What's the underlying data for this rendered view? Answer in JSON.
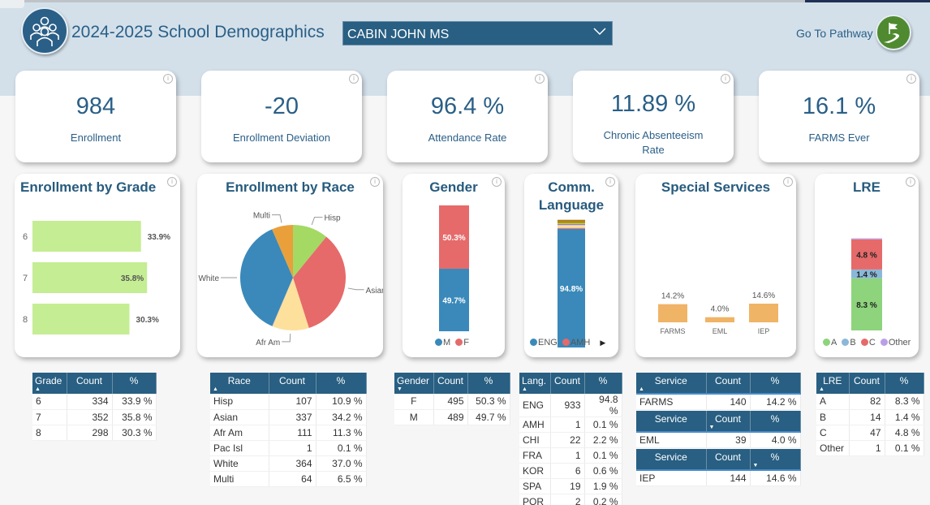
{
  "header": {
    "title": "2024-2025 School Demographics",
    "school_selected": "CABIN JOHN MS",
    "pathway_label": "Go To Pathway"
  },
  "kpis": [
    {
      "value": "984",
      "label": "Enrollment"
    },
    {
      "value": "-20",
      "label": "Enrollment Deviation"
    },
    {
      "value": "96.4 %",
      "label": "Attendance Rate"
    },
    {
      "value": "11.89 %",
      "label": "Chronic Absenteeism Rate"
    },
    {
      "value": "16.1 %",
      "label": "FARMS Ever"
    }
  ],
  "info_icon": "i",
  "colors": {
    "brand": "#285f82",
    "grade_bar": "#c5ed94",
    "service_bar": "#f0b466",
    "m": "#3a89ba",
    "f": "#e66a6a"
  },
  "chart_data": [
    {
      "type": "bar",
      "orientation": "horizontal",
      "title": "Enrollment by Grade",
      "categories": [
        "6",
        "7",
        "8"
      ],
      "values": [
        33.9,
        35.8,
        30.3
      ],
      "labels": [
        "33.9%",
        "35.8%",
        "30.3%"
      ],
      "color": "#c5ed94"
    },
    {
      "type": "pie",
      "title": "Enrollment by Race",
      "categories": [
        "Hisp",
        "Asian",
        "Afr Am",
        "Pac Isl",
        "White",
        "Multi"
      ],
      "values": [
        10.9,
        34.2,
        11.3,
        0.1,
        37.0,
        6.5
      ],
      "colors": [
        "#a4d964",
        "#e66a6a",
        "#fde09c",
        "#8a6fc0",
        "#3a89ba",
        "#e9a03b"
      ],
      "slice_labels": [
        "Hisp",
        "Asian",
        "Afr Am",
        "",
        "White",
        "Multi"
      ]
    },
    {
      "type": "bar",
      "stacked": true,
      "title": "Gender",
      "series": [
        {
          "name": "M",
          "value": 49.7,
          "label": "49.7%",
          "color": "#3a89ba"
        },
        {
          "name": "F",
          "value": 50.3,
          "label": "50.3%",
          "color": "#e66a6a"
        }
      ],
      "legend": [
        "M",
        "F"
      ]
    },
    {
      "type": "bar",
      "stacked": true,
      "title": "Comm. Language",
      "series": [
        {
          "name": "ENG",
          "value": 94.8,
          "label": "94.8%",
          "color": "#3a89ba"
        },
        {
          "name": "AMH",
          "value": 0.1,
          "label": "",
          "color": "#e66a6a"
        },
        {
          "name": "CHI",
          "value": 2.2,
          "label": "",
          "color": "#fde09c"
        },
        {
          "name": "FRA",
          "value": 0.1,
          "label": "",
          "color": "#8a6fc0"
        },
        {
          "name": "KOR",
          "value": 0.6,
          "label": "",
          "color": "#a4d964"
        },
        {
          "name": "SPA",
          "value": 1.9,
          "label": "",
          "color": "#b8860b"
        },
        {
          "name": "POR",
          "value": 0.2,
          "label": "",
          "color": "#9c7a1a"
        }
      ],
      "legend": [
        "ENG",
        "AMH"
      ]
    },
    {
      "type": "bar",
      "title": "Special Services",
      "categories": [
        "FARMS",
        "EML",
        "IEP"
      ],
      "values": [
        14.2,
        4.0,
        14.6
      ],
      "labels": [
        "14.2%",
        "4.0%",
        "14.6%"
      ],
      "color": "#f0b466"
    },
    {
      "type": "bar",
      "stacked": true,
      "title": "LRE",
      "series": [
        {
          "name": "A",
          "value": 8.3,
          "label": "8.3 %",
          "color": "#8dd47c"
        },
        {
          "name": "B",
          "value": 1.4,
          "label": "1.4 %",
          "color": "#8ab8d8"
        },
        {
          "name": "C",
          "value": 4.8,
          "label": "4.8 %",
          "color": "#e66a6a"
        },
        {
          "name": "Other",
          "value": 0.1,
          "label": "",
          "color": "#b9a0e6"
        }
      ],
      "legend": [
        "A",
        "B",
        "C",
        "Other"
      ]
    }
  ],
  "tables": {
    "grade": {
      "headers": [
        "Grade",
        "Count",
        "%"
      ],
      "rows": [
        [
          "6",
          "334",
          "33.9 %"
        ],
        [
          "7",
          "352",
          "35.8 %"
        ],
        [
          "8",
          "298",
          "30.3 %"
        ]
      ]
    },
    "race": {
      "headers": [
        "Race",
        "Count",
        "%"
      ],
      "rows": [
        [
          "Hisp",
          "107",
          "10.9 %"
        ],
        [
          "Asian",
          "337",
          "34.2 %"
        ],
        [
          "Afr Am",
          "111",
          "11.3 %"
        ],
        [
          "Pac Isl",
          "1",
          "0.1 %"
        ],
        [
          "White",
          "364",
          "37.0 %"
        ],
        [
          "Multi",
          "64",
          "6.5 %"
        ]
      ]
    },
    "gender": {
      "headers": [
        "Gender",
        "Count",
        "%"
      ],
      "rows": [
        [
          "F",
          "495",
          "50.3 %"
        ],
        [
          "M",
          "489",
          "49.7 %"
        ]
      ]
    },
    "language": {
      "headers": [
        "Lang.",
        "Count",
        "%"
      ],
      "rows": [
        [
          "ENG",
          "933",
          "94.8 %"
        ],
        [
          "AMH",
          "1",
          "0.1 %"
        ],
        [
          "CHI",
          "22",
          "2.2 %"
        ],
        [
          "FRA",
          "1",
          "0.1 %"
        ],
        [
          "KOR",
          "6",
          "0.6 %"
        ],
        [
          "SPA",
          "19",
          "1.9 %"
        ],
        [
          "POR",
          "2",
          "0.2 %"
        ]
      ]
    },
    "services": [
      {
        "headers": [
          "Service",
          "Count",
          "%"
        ],
        "rows": [
          [
            "FARMS",
            "140",
            "14.2 %"
          ]
        ]
      },
      {
        "headers": [
          "Service",
          "Count",
          "%"
        ],
        "rows": [
          [
            "EML",
            "39",
            "4.0 %"
          ]
        ]
      },
      {
        "headers": [
          "Service",
          "Count",
          "%"
        ],
        "rows": [
          [
            "IEP",
            "144",
            "14.6 %"
          ]
        ]
      }
    ],
    "lre": {
      "headers": [
        "LRE",
        "Count",
        "%"
      ],
      "rows": [
        [
          "A",
          "82",
          "8.3 %"
        ],
        [
          "B",
          "14",
          "1.4 %"
        ],
        [
          "C",
          "47",
          "4.8 %"
        ],
        [
          "Other",
          "1",
          "0.1 %"
        ]
      ]
    }
  }
}
